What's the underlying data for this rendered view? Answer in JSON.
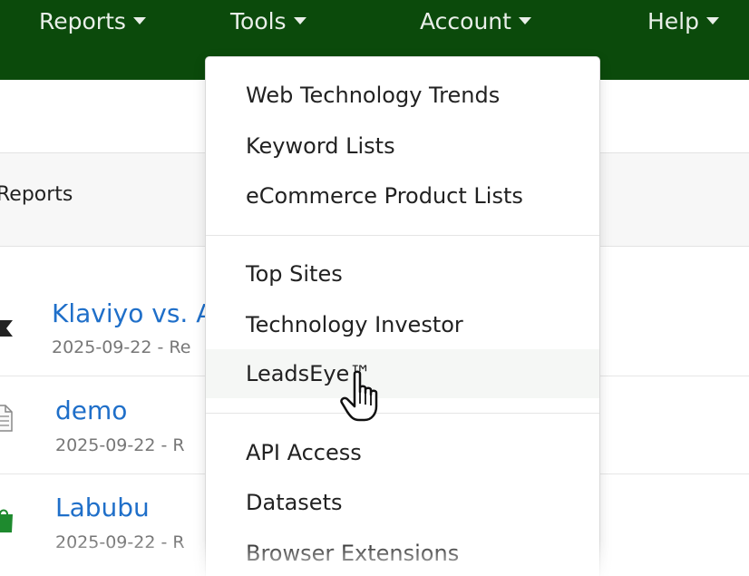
{
  "navbar": {
    "items": [
      {
        "label": "Reports"
      },
      {
        "label": "Tools"
      },
      {
        "label": "Account"
      },
      {
        "label": "Help"
      }
    ]
  },
  "sub_header": {
    "label": "Reports"
  },
  "reports": [
    {
      "title": "Klaviyo vs. A",
      "meta": "2025-09-22 -  Re",
      "icon": "tag-icon"
    },
    {
      "title": "demo",
      "meta": "2025-09-22 -  R",
      "icon": "document-icon"
    },
    {
      "title": "Labubu",
      "meta": "2025-09-22 -  R",
      "icon": "shopping-bag-icon"
    }
  ],
  "tools_menu": {
    "groups": [
      [
        "Web Technology Trends",
        "Keyword Lists",
        "eCommerce Product Lists"
      ],
      [
        "Top Sites",
        "Technology Investor",
        "LeadsEye™"
      ],
      [
        "API Access",
        "Datasets",
        "Browser Extensions"
      ]
    ],
    "hovered": "LeadsEye™"
  },
  "colors": {
    "navbar_bg": "#0b4a0b",
    "link": "#1f6fc9",
    "icon_green": "#1e8a2e"
  }
}
